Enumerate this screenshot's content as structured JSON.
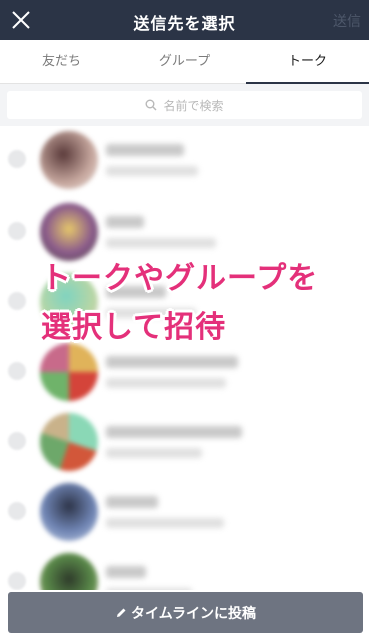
{
  "header": {
    "title": "送信先を選択",
    "send_label": "送信"
  },
  "tabs": [
    {
      "label": "友だち",
      "active": false
    },
    {
      "label": "グループ",
      "active": false
    },
    {
      "label": "トーク",
      "active": true
    }
  ],
  "search": {
    "placeholder": "名前で検索"
  },
  "overlay": {
    "line1": "トークやグループを",
    "line2": "選択して招待"
  },
  "footer": {
    "post_label": "タイムラインに投稿"
  },
  "colors": {
    "header_bg": "#2b3446",
    "accent": "#e4307a",
    "button_bg": "#6e7481"
  }
}
